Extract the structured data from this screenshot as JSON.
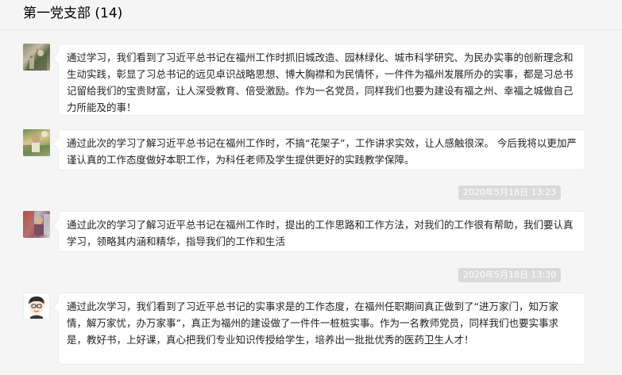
{
  "header": {
    "title": "第一党支部 (14)"
  },
  "messages": [
    {
      "avatar": "member-photo-avatar",
      "text": "通过学习，我们看到了习近平总书记在福州工作时抓旧城改造、园林绿化、城市科学研究、为民办实事的创新理念和生动实践，彰显了习总书记的远见卓识战略思想、博大胸襟和为民情怀，一件件为福州发展所办的实事，都是习总书记留给我们的宝贵财富，让人深受教育、倍受激励。作为一名党员，同样我们也要为建设有福之州、幸福之城做自己力所能及的事！"
    },
    {
      "avatar": "member-photo-avatar",
      "text": "通过此次的学习了解习近平总书记在福州工作时，不搞“花架子”，工作讲求实效，让人感触很深。 今后我将以更加严谨认真的工作态度做好本职工作，为科任老师及学生提供更好的实践教学保障。"
    },
    {
      "avatar": "member-photo-avatar",
      "text": "通过此次的学习了解习近平总书记在福州工作时，提出的工作思路和工作方法，对我们的工作很有帮助，我们要认真学习，领略其内涵和精华，指导我们的工作和生活"
    },
    {
      "avatar": "cartoon-avatar",
      "text": "通过此次学习，我们看到了习近平总书记的实事求是的工作态度，在福州任职期间真正做到了“进万家门，知万家情，解万家忧，办万家事”，真正为福州的建设做了一件件一桩桩实事。作为一名教师党员，同样我们也要实事求是，教好书，上好课，真心把我们专业知识传授给学生，培养出一批批优秀的医药卫生人才！"
    }
  ],
  "timestamps": [
    "2020年5月18日 13:23",
    "2020年5月18日 13:30"
  ]
}
